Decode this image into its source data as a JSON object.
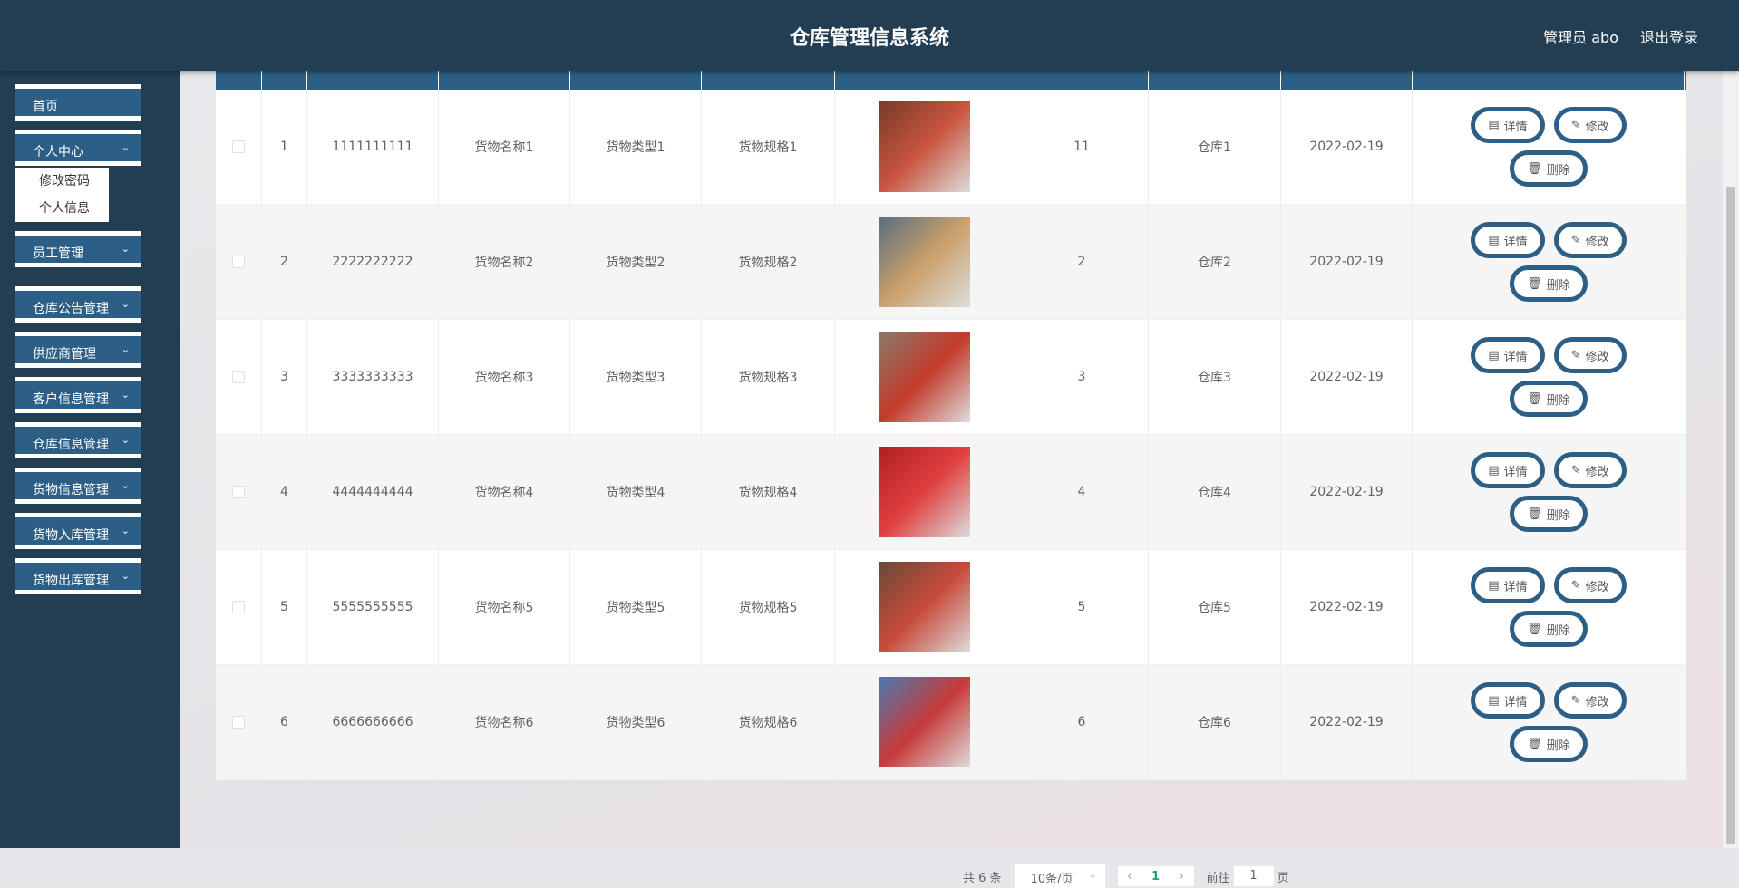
{
  "header": {
    "title": "仓库管理信息系统",
    "user": "管理员 abo",
    "logout": "退出登录"
  },
  "sidebar": {
    "items": [
      {
        "label": "首页",
        "chevron": false
      },
      {
        "label": "个人中心",
        "chevron": true
      },
      {
        "label": "员工管理",
        "chevron": true
      },
      {
        "label": "仓库公告管理",
        "chevron": true
      },
      {
        "label": "供应商管理",
        "chevron": true
      },
      {
        "label": "客户信息管理",
        "chevron": true
      },
      {
        "label": "仓库信息管理",
        "chevron": true
      },
      {
        "label": "货物信息管理",
        "chevron": true
      },
      {
        "label": "货物入库管理",
        "chevron": true
      },
      {
        "label": "货物出库管理",
        "chevron": true
      }
    ],
    "submenu": [
      "修改密码",
      "个人信息"
    ]
  },
  "table": {
    "rows": [
      {
        "index": "1",
        "code": "1111111111",
        "name": "货物名称1",
        "type": "货物类型1",
        "spec": "货物规格1",
        "qty": "11",
        "warehouse": "仓库1",
        "date": "2022-02-19"
      },
      {
        "index": "2",
        "code": "2222222222",
        "name": "货物名称2",
        "type": "货物类型2",
        "spec": "货物规格2",
        "qty": "2",
        "warehouse": "仓库2",
        "date": "2022-02-19"
      },
      {
        "index": "3",
        "code": "3333333333",
        "name": "货物名称3",
        "type": "货物类型3",
        "spec": "货物规格3",
        "qty": "3",
        "warehouse": "仓库3",
        "date": "2022-02-19"
      },
      {
        "index": "4",
        "code": "4444444444",
        "name": "货物名称4",
        "type": "货物类型4",
        "spec": "货物规格4",
        "qty": "4",
        "warehouse": "仓库4",
        "date": "2022-02-19"
      },
      {
        "index": "5",
        "code": "5555555555",
        "name": "货物名称5",
        "type": "货物类型5",
        "spec": "货物规格5",
        "qty": "5",
        "warehouse": "仓库5",
        "date": "2022-02-19"
      },
      {
        "index": "6",
        "code": "6666666666",
        "name": "货物名称6",
        "type": "货物类型6",
        "spec": "货物规格6",
        "qty": "6",
        "warehouse": "仓库6",
        "date": "2022-02-19"
      }
    ],
    "actions": {
      "detail": "详情",
      "edit": "修改",
      "delete": "删除"
    }
  },
  "pagination": {
    "total": "共 6 条",
    "page_size": "10条/页",
    "current": "1",
    "goto_label": "前往",
    "goto_value": "1",
    "page_suffix": "页"
  },
  "colors": {
    "header": "#233e52",
    "accent": "#2d5f86",
    "page_active": "#16a37a"
  }
}
